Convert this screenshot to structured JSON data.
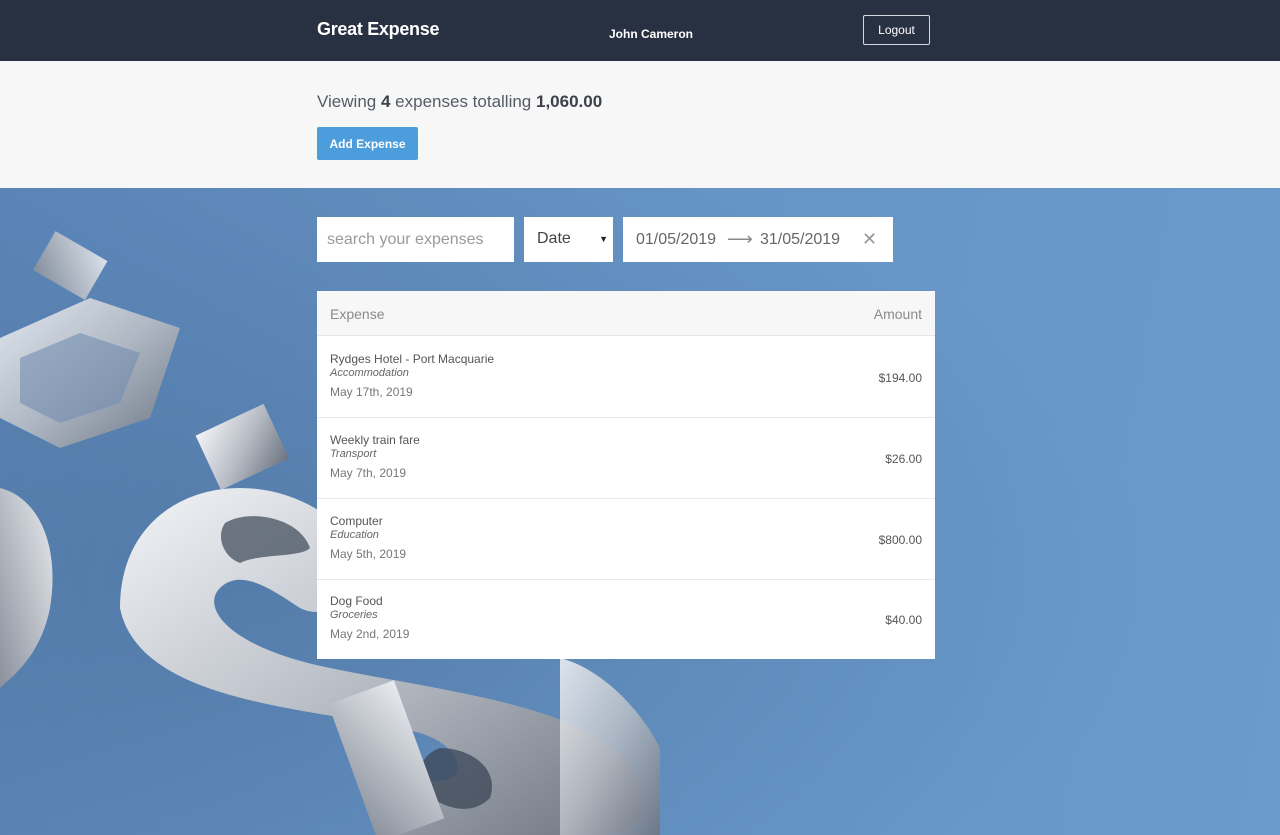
{
  "header": {
    "brand": "Great Expense",
    "user_name": "John Cameron",
    "logout_label": "Logout"
  },
  "summary": {
    "prefix": "Viewing",
    "count": "4",
    "middle": "expenses totalling",
    "total": "1,060.00",
    "add_button_label": "Add Expense"
  },
  "filters": {
    "search_placeholder": "search your expenses",
    "search_value": "",
    "sort_selected": "Date",
    "date_start": "01/05/2019",
    "date_end": "31/05/2019"
  },
  "table": {
    "columns": [
      "Expense",
      "Amount"
    ],
    "rows": [
      {
        "description": "Rydges Hotel - Port Macquarie",
        "category": "Accommodation",
        "date": "May 17th, 2019",
        "amount": "$194.00"
      },
      {
        "description": "Weekly train fare",
        "category": "Transport",
        "date": "May 7th, 2019",
        "amount": "$26.00"
      },
      {
        "description": "Computer",
        "category": "Education",
        "date": "May 5th, 2019",
        "amount": "$800.00"
      },
      {
        "description": "Dog Food",
        "category": "Groceries",
        "date": "May 2nd, 2019",
        "amount": "$40.00"
      }
    ]
  },
  "icons": {
    "sort_dropdown": "caret-down-icon",
    "date_separator": "arrow-right-icon",
    "date_clear": "close-icon"
  },
  "colors": {
    "header_bg": "#283142",
    "accent": "#4b9ddb",
    "background_blue": "#6593c4"
  }
}
